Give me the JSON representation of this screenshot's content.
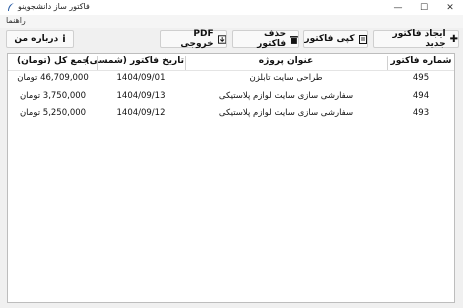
{
  "window": {
    "title": "فاکتور ساز دانشجوینو",
    "minimize_glyph": "—",
    "maximize_glyph": "☐",
    "close_glyph": "✕"
  },
  "menu": {
    "help": "راهنما"
  },
  "toolbar": {
    "new_invoice": "ایجاد فاکتور جدید",
    "copy_invoice": "کپی فاکتور",
    "delete_invoice": "حذف فاکتور",
    "export_pdf": "PDF خروجی",
    "about": "درباره من"
  },
  "table": {
    "headers": {
      "invoice_number": "شماره فاکتور",
      "project_title": "عنوان پروژه",
      "invoice_date": "تاریخ فاکتور (شمسی)",
      "total": "جمع کل (تومان)"
    },
    "rows": [
      {
        "number": "495",
        "title": "طراحی سایت تابلزن",
        "date": "1404/09/01",
        "total": "46,709,000 تومان"
      },
      {
        "number": "494",
        "title": "سفارشی سازی سایت لوازم پلاستیکی",
        "date": "1404/09/13",
        "total": "3,750,000 تومان"
      },
      {
        "number": "493",
        "title": "سفارشی سازی سایت لوازم پلاستیکی",
        "date": "1404/09/12",
        "total": "5,250,000 تومان"
      }
    ]
  }
}
